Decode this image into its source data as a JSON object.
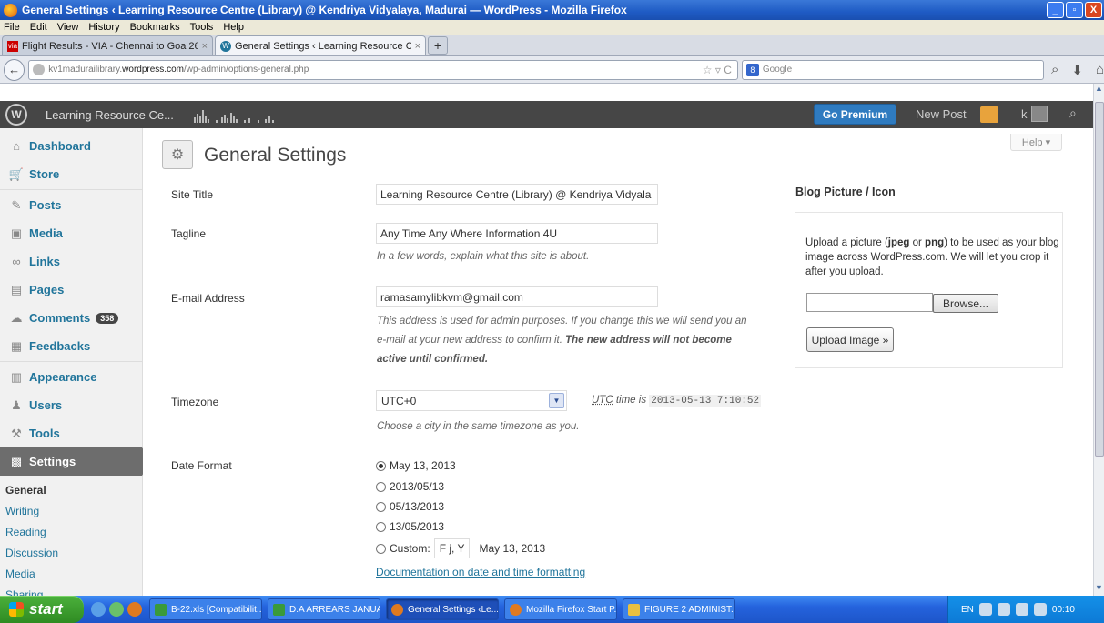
{
  "window": {
    "title": "General Settings ‹ Learning Resource Centre (Library) @ Kendriya Vidyalaya, Madurai — WordPress - Mozilla Firefox",
    "controls": [
      "_",
      "▫",
      "X"
    ]
  },
  "menubar": [
    "File",
    "Edit",
    "View",
    "History",
    "Bookmarks",
    "Tools",
    "Help"
  ],
  "tabs": [
    {
      "label": "Flight Results - VIA - Chennai to Goa 26 ...",
      "close": "×"
    },
    {
      "label": "General Settings ‹ Learning Resource Ce...",
      "close": "×"
    }
  ],
  "newtab": "+",
  "navbar": {
    "back": "←",
    "url_prefix": "kv1madurailibrary.",
    "url_domain": "wordpress.com",
    "url_path": "/wp-admin/options-general.php",
    "url_extras": "☆ ▿ C",
    "search_placeholder": "Google",
    "search_engine": "8"
  },
  "adminbar": {
    "wp_logo": "W",
    "site_name": "Learning Resource Ce...",
    "go_premium": "Go Premium",
    "new_post": "New Post",
    "user": "k",
    "search_icon": "🔍"
  },
  "sidebar": {
    "items": [
      {
        "label": "Dashboard",
        "icon": "⌂"
      },
      {
        "label": "Store",
        "icon": "🛒"
      },
      {
        "label": "Posts",
        "icon": "✎"
      },
      {
        "label": "Media",
        "icon": "▣"
      },
      {
        "label": "Links",
        "icon": "∞"
      },
      {
        "label": "Pages",
        "icon": "▤"
      },
      {
        "label": "Comments",
        "icon": "☁",
        "badge": "358"
      },
      {
        "label": "Feedbacks",
        "icon": "▦"
      },
      {
        "label": "Appearance",
        "icon": "▥"
      },
      {
        "label": "Users",
        "icon": "♟"
      },
      {
        "label": "Tools",
        "icon": "⚒"
      },
      {
        "label": "Settings",
        "icon": "▩"
      }
    ],
    "submenu": [
      "General",
      "Writing",
      "Reading",
      "Discussion",
      "Media",
      "Sharing"
    ]
  },
  "main": {
    "help": "Help ▾",
    "page_title": "General Settings",
    "site_title_label": "Site Title",
    "site_title_value": "Learning Resource Centre (Library) @ Kendriya Vidyala",
    "tagline_label": "Tagline",
    "tagline_value": "Any Time Any Where Information 4U",
    "tagline_desc": "In a few words, explain what this site is about.",
    "email_label": "E-mail Address",
    "email_value": "ramasamylibkvm@gmail.com",
    "email_desc_1": "This address is used for admin purposes. If you change this we will send you an",
    "email_desc_2": "e-mail at your new address to confirm it.",
    "email_desc_bold_1": "The new address will not become",
    "email_desc_bold_2": "active until confirmed.",
    "timezone_label": "Timezone",
    "timezone_value": "UTC+0",
    "utc_prefix": "UTC",
    "utc_mid": "time is",
    "utc_time": "2013-05-13 7:10:52",
    "timezone_desc": "Choose a city in the same timezone as you.",
    "date_format_label": "Date Format",
    "date_options": [
      "May 13, 2013",
      "2013/05/13",
      "05/13/2013",
      "13/05/2013"
    ],
    "custom_label": "Custom:",
    "custom_value": "F j, Y",
    "custom_preview": "May 13, 2013",
    "doc_link": "Documentation on date and time formatting"
  },
  "blog_picture": {
    "title": "Blog Picture / Icon",
    "text_1": "Upload a picture (",
    "jpeg": "jpeg",
    "text_2": " or ",
    "png": "png",
    "text_3": ") to be used as your blog image across WordPress.com. We will let you crop it after you upload.",
    "browse": "Browse...",
    "upload": "Upload Image »"
  },
  "taskbar": {
    "start": "start",
    "buttons": [
      "B-22.xls [Compatibilit...",
      "D.A ARREARS JANUA...",
      "General Settings ‹Le...",
      "Mozilla Firefox Start P...",
      "FIGURE 2 ADMINIST..."
    ],
    "lang": "EN",
    "clock": "00:10"
  },
  "colors": {
    "wp_link": "#21759b",
    "admin_bar": "#464646",
    "go_premium": "#2f7bc0",
    "xp_taskbar": "#2563dd",
    "xp_start": "#2f8b22"
  }
}
